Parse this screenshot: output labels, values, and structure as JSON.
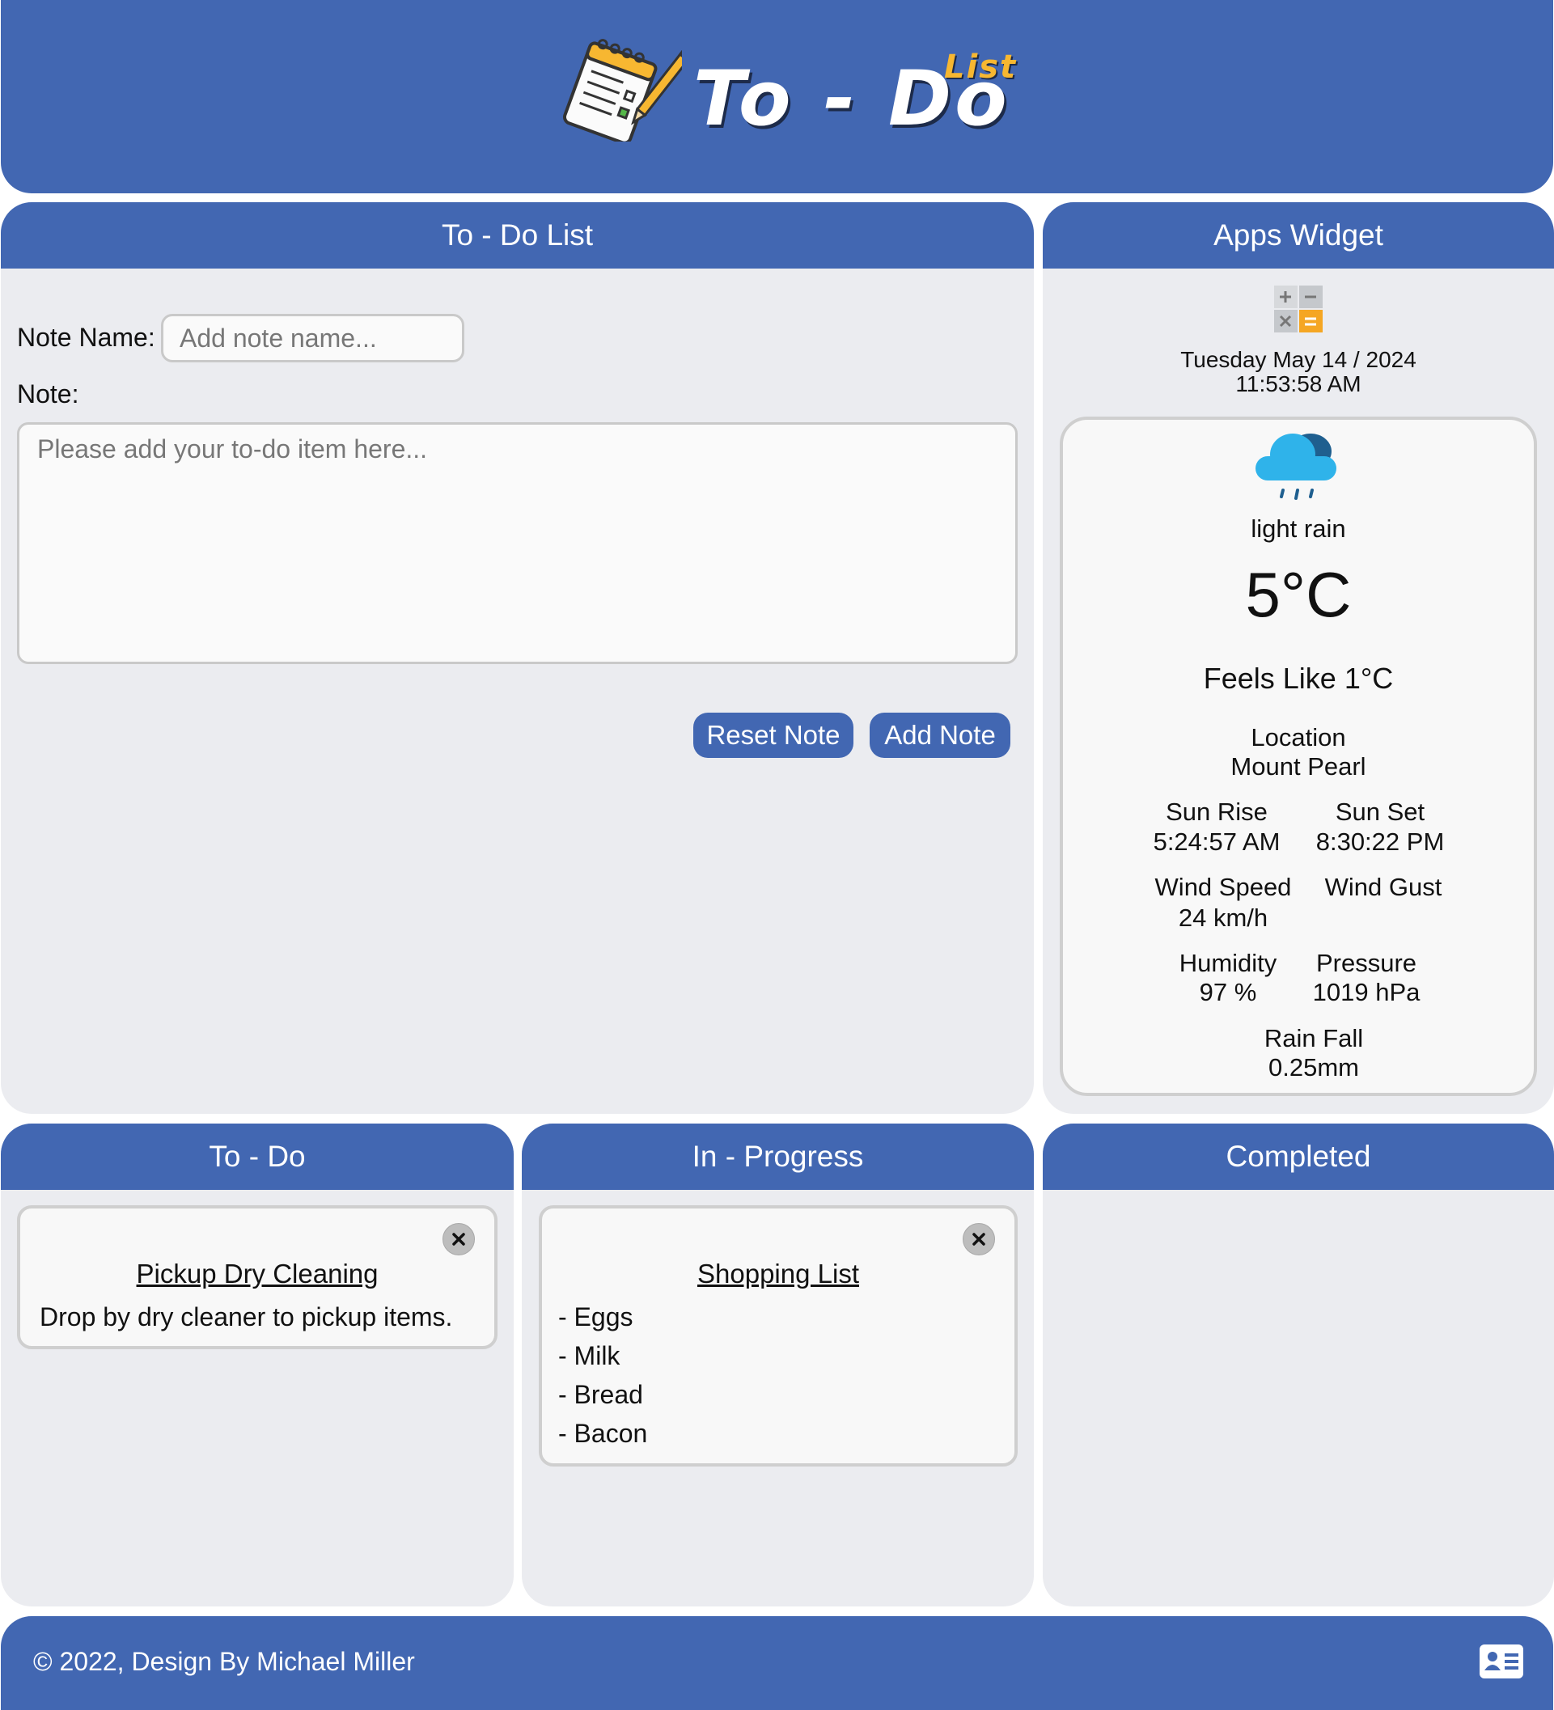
{
  "header": {
    "title": "To - Do",
    "subtitle": "List"
  },
  "form": {
    "heading": "To - Do List",
    "note_name_label": "Note Name:",
    "note_name_placeholder": "Add note name...",
    "note_label": "Note:",
    "note_placeholder": "Please add your to-do item here...",
    "reset_label": "Reset Note",
    "add_label": "Add Note"
  },
  "widget": {
    "heading": "Apps Widget",
    "date": "Tuesday May 14 / 2024",
    "time": "11:53:58 AM",
    "weather": {
      "icon": "rain-cloud-icon",
      "condition": "light rain",
      "temperature": "5°C",
      "feels_like": "Feels Like 1°C",
      "location_label": "Location",
      "location": "Mount Pearl",
      "sunrise_label": "Sun Rise",
      "sunrise": "5:24:57 AM",
      "sunset_label": "Sun Set",
      "sunset": "8:30:22 PM",
      "wind_speed_label": "Wind Speed",
      "wind_speed": "24 km/h",
      "wind_gust_label": "Wind Gust",
      "wind_gust": "",
      "humidity_label": "Humidity",
      "humidity": "97 %",
      "pressure_label": "Pressure",
      "pressure": "1019 hPa",
      "rainfall_label": "Rain Fall",
      "rainfall": "0.25mm"
    }
  },
  "columns": {
    "todo": {
      "heading": "To - Do",
      "notes": [
        {
          "title": "Pickup Dry Cleaning",
          "body": "Drop by dry cleaner to pickup items."
        }
      ]
    },
    "progress": {
      "heading": "In - Progress",
      "notes": [
        {
          "title": "Shopping List",
          "lines": [
            "- Eggs",
            "- Milk",
            "- Bread",
            "- Bacon"
          ]
        }
      ]
    },
    "done": {
      "heading": "Completed",
      "notes": []
    }
  },
  "footer": {
    "copyright": "© 2022, Design By Michael Miller",
    "contact_icon": "contact-card-icon"
  },
  "colors": {
    "primary": "#4267b2",
    "panel": "#ebecf0",
    "accent": "#f7b731"
  }
}
